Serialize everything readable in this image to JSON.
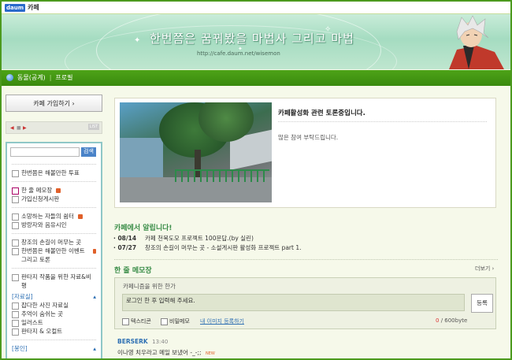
{
  "topbar": {
    "logo": "daum",
    "cafe_label": "카페"
  },
  "banner": {
    "title": "한번쯤은 꿈꿔봤을 마법사 그리고 마법",
    "url": "http://cafe.daum.net/wisemon"
  },
  "nav": {
    "items": [
      {
        "label": "동물(공계)"
      },
      {
        "label": "프로필"
      }
    ]
  },
  "sidebar": {
    "join_label": "카페 가입하기 ›",
    "player": {
      "list_label": "LIST"
    },
    "search": {
      "placeholder": "",
      "button": "검색"
    },
    "groups": [
      {
        "items": [
          {
            "label": "한번쯤은 해볼만한 투표",
            "new": false
          }
        ]
      },
      {
        "items": [
          {
            "label": "한 줄 메모장",
            "new": true
          },
          {
            "label": "가입신청게시판",
            "new": false
          }
        ]
      },
      {
        "items": [
          {
            "label": "소망하는 자들의 쉼터",
            "new": true
          },
          {
            "label": "방랑자와 음유시인",
            "new": false
          }
        ]
      },
      {
        "items": [
          {
            "label": "창조의 손길이 머무는 곳",
            "new": false
          },
          {
            "label": "한번쯤은 해볼만한 이벤트 그리고 토론",
            "new": true
          }
        ]
      },
      {
        "items": [
          {
            "label": "판타지 작품을 위한 자료&비평",
            "new": false
          }
        ]
      }
    ],
    "category1": {
      "label": "[자료실]"
    },
    "category1_items": [
      {
        "label": "잡다한 사진 자료실"
      },
      {
        "label": "추억이 숨쉬는 곳"
      },
      {
        "label": "일러스트"
      },
      {
        "label": "판타지 & 오컬트"
      }
    ],
    "category2": {
      "label": "[봉인]"
    }
  },
  "notice": {
    "title": "카페활성화 관련 토론중입니다.",
    "body": "많은 참여 부탁드립니다."
  },
  "announcements": {
    "title": "카페에서 알립니다!",
    "items": [
      {
        "date": "08/14",
        "text": "카페 천목도모 프로젝트 100문답.(by 실린)"
      },
      {
        "date": "07/27",
        "text": "창조의 손길이 머무는 곳 - 소설게시판 활성화 프로젝트 part 1."
      }
    ]
  },
  "memo": {
    "title": "한 줄 메모장",
    "more": "더보기 ›",
    "label": "카페니즘을 위한 한가",
    "input_placeholder": "로그인 한 후 입력해 주세요.",
    "register": "등록",
    "emoticon": "텍스티콘",
    "secret": "비밀메모",
    "image_link": "내 이미지 등록하기",
    "count": "0",
    "limit": " / 600byte",
    "comment": {
      "name": "BERSERK",
      "time": "13:40",
      "text": "이나영 치우라고 메일 보냈어 -_-;;",
      "badge": "NEW"
    }
  }
}
